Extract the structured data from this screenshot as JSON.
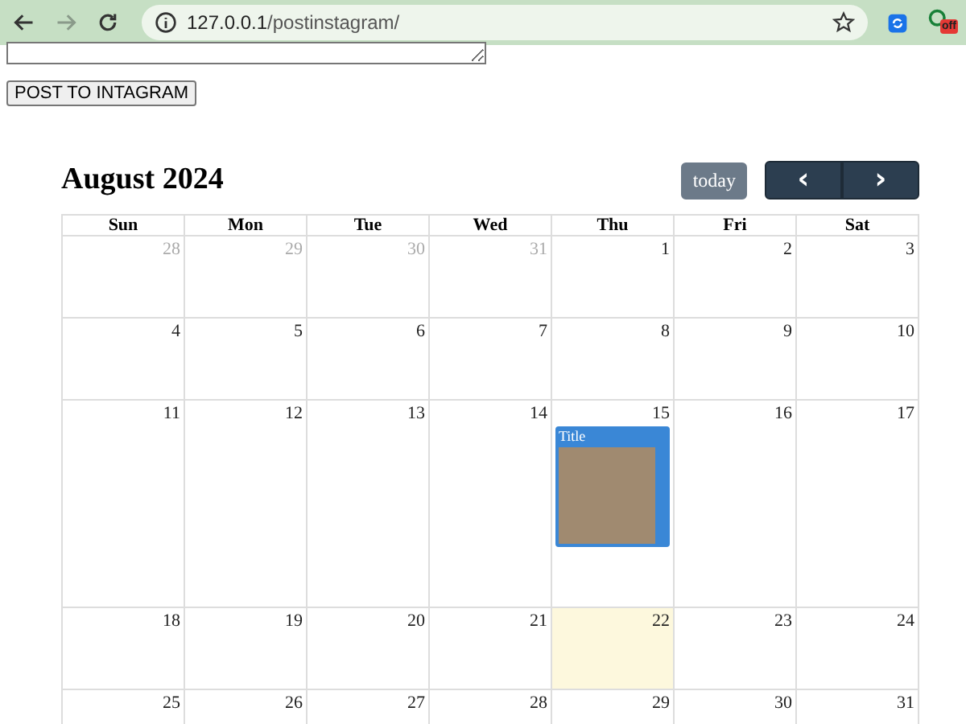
{
  "browser": {
    "url_host": "127.0.0.1",
    "url_path": "/postinstagram/",
    "forward_disabled": true,
    "extension_badge": "off"
  },
  "form": {
    "post_button": "POST TO INTAGRAM"
  },
  "calendar": {
    "title": "August 2024",
    "today_button": {
      "label": "today",
      "disabled": true
    },
    "prev_button": "‹",
    "next_button": "›",
    "weekdays": [
      "Sun",
      "Mon",
      "Tue",
      "Wed",
      "Thu",
      "Fri",
      "Sat"
    ],
    "weeks": [
      {
        "days": [
          {
            "day": "28",
            "other_month": true,
            "today": false
          },
          {
            "day": "29",
            "other_month": true,
            "today": false
          },
          {
            "day": "30",
            "other_month": true,
            "today": false
          },
          {
            "day": "31",
            "other_month": true,
            "today": false
          },
          {
            "day": "1",
            "other_month": false,
            "today": false
          },
          {
            "day": "2",
            "other_month": false,
            "today": false
          },
          {
            "day": "3",
            "other_month": false,
            "today": false
          }
        ]
      },
      {
        "days": [
          {
            "day": "4",
            "other_month": false,
            "today": false
          },
          {
            "day": "5",
            "other_month": false,
            "today": false
          },
          {
            "day": "6",
            "other_month": false,
            "today": false
          },
          {
            "day": "7",
            "other_month": false,
            "today": false
          },
          {
            "day": "8",
            "other_month": false,
            "today": false
          },
          {
            "day": "9",
            "other_month": false,
            "today": false
          },
          {
            "day": "10",
            "other_month": false,
            "today": false
          }
        ]
      },
      {
        "days": [
          {
            "day": "11",
            "other_month": false,
            "today": false
          },
          {
            "day": "12",
            "other_month": false,
            "today": false
          },
          {
            "day": "13",
            "other_month": false,
            "today": false
          },
          {
            "day": "14",
            "other_month": false,
            "today": false
          },
          {
            "day": "15",
            "other_month": false,
            "today": false,
            "events": [
              {
                "title": "Title"
              }
            ]
          },
          {
            "day": "16",
            "other_month": false,
            "today": false
          },
          {
            "day": "17",
            "other_month": false,
            "today": false
          }
        ]
      },
      {
        "days": [
          {
            "day": "18",
            "other_month": false,
            "today": false
          },
          {
            "day": "19",
            "other_month": false,
            "today": false
          },
          {
            "day": "20",
            "other_month": false,
            "today": false
          },
          {
            "day": "21",
            "other_month": false,
            "today": false
          },
          {
            "day": "22",
            "other_month": false,
            "today": true
          },
          {
            "day": "23",
            "other_month": false,
            "today": false
          },
          {
            "day": "24",
            "other_month": false,
            "today": false
          }
        ]
      },
      {
        "days": [
          {
            "day": "25",
            "other_month": false,
            "today": false
          },
          {
            "day": "26",
            "other_month": false,
            "today": false
          },
          {
            "day": "27",
            "other_month": false,
            "today": false
          },
          {
            "day": "28",
            "other_month": false,
            "today": false
          },
          {
            "day": "29",
            "other_month": false,
            "today": false
          },
          {
            "day": "30",
            "other_month": false,
            "today": false
          },
          {
            "day": "31",
            "other_month": false,
            "today": false
          }
        ]
      }
    ]
  }
}
